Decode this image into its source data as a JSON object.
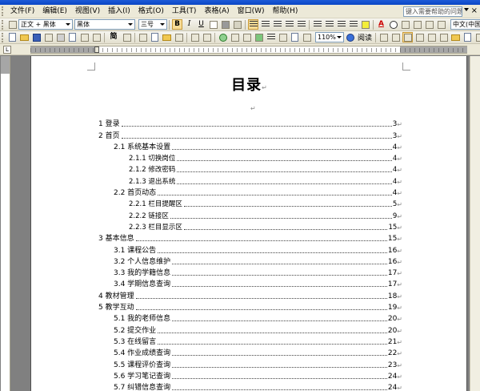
{
  "menu": {
    "items": [
      "文件(F)",
      "编辑(E)",
      "视图(V)",
      "插入(I)",
      "格式(O)",
      "工具(T)",
      "表格(A)",
      "窗口(W)",
      "帮助(H)"
    ],
    "help_placeholder": "键入需要帮助的问题",
    "close_glyph": "×"
  },
  "format_toolbar": {
    "style_value": "正文 + 黑体",
    "font_value": "黑体",
    "size_value": "三号",
    "bold": "B",
    "italic": "I",
    "underline": "U",
    "font_color_letter": "A",
    "language_value": "中文(中国)"
  },
  "standard_toolbar": {
    "simplified_label": "简",
    "zoom_value": "110%",
    "read_label": "阅读"
  },
  "ruler": {
    "tab_glyph": "L"
  },
  "document": {
    "title": "目录",
    "paragraph_mark": "↵",
    "toc": [
      {
        "level": 1,
        "label": "1 登录",
        "page": "3"
      },
      {
        "level": 1,
        "label": "2 首页",
        "page": "3"
      },
      {
        "level": 2,
        "label": "2.1 系统基本设置",
        "page": "4"
      },
      {
        "level": 3,
        "label": "2.1.1 切换岗位",
        "page": "4"
      },
      {
        "level": 3,
        "label": "2.1.2 修改密码",
        "page": "4"
      },
      {
        "level": 3,
        "label": "2.1.3 退出系统",
        "page": "4"
      },
      {
        "level": 2,
        "label": "2.2 首页动态",
        "page": "4"
      },
      {
        "level": 3,
        "label": "2.2.1 栏目提醒区",
        "page": "5"
      },
      {
        "level": 3,
        "label": "2.2.2 链接区",
        "page": "9"
      },
      {
        "level": 3,
        "label": "2.2.3 栏目显示区",
        "page": "15"
      },
      {
        "level": 1,
        "label": "3 基本信息",
        "page": "15"
      },
      {
        "level": 2,
        "label": "3.1 课程公告",
        "page": "16"
      },
      {
        "level": 2,
        "label": "3.2 个人信息维护",
        "page": "16"
      },
      {
        "level": 2,
        "label": "3.3 我的学籍信息",
        "page": "17"
      },
      {
        "level": 2,
        "label": "3.4 学期信息查询",
        "page": "17"
      },
      {
        "level": 1,
        "label": "4 教材管理",
        "page": "18"
      },
      {
        "level": 1,
        "label": "5 教学互动",
        "page": "19"
      },
      {
        "level": 2,
        "label": "5.1 我的老师信息",
        "page": "20"
      },
      {
        "level": 2,
        "label": "5.2 提交作业",
        "page": "20"
      },
      {
        "level": 2,
        "label": "5.3 在线留言",
        "page": "21"
      },
      {
        "level": 2,
        "label": "5.4 作业成绩查询",
        "page": "22"
      },
      {
        "level": 2,
        "label": "5.5 课程评价查询",
        "page": "23"
      },
      {
        "level": 2,
        "label": "5.6 学习笔记查询",
        "page": "24"
      },
      {
        "level": 2,
        "label": "5.7 纠错信息查询",
        "page": "24"
      }
    ]
  }
}
